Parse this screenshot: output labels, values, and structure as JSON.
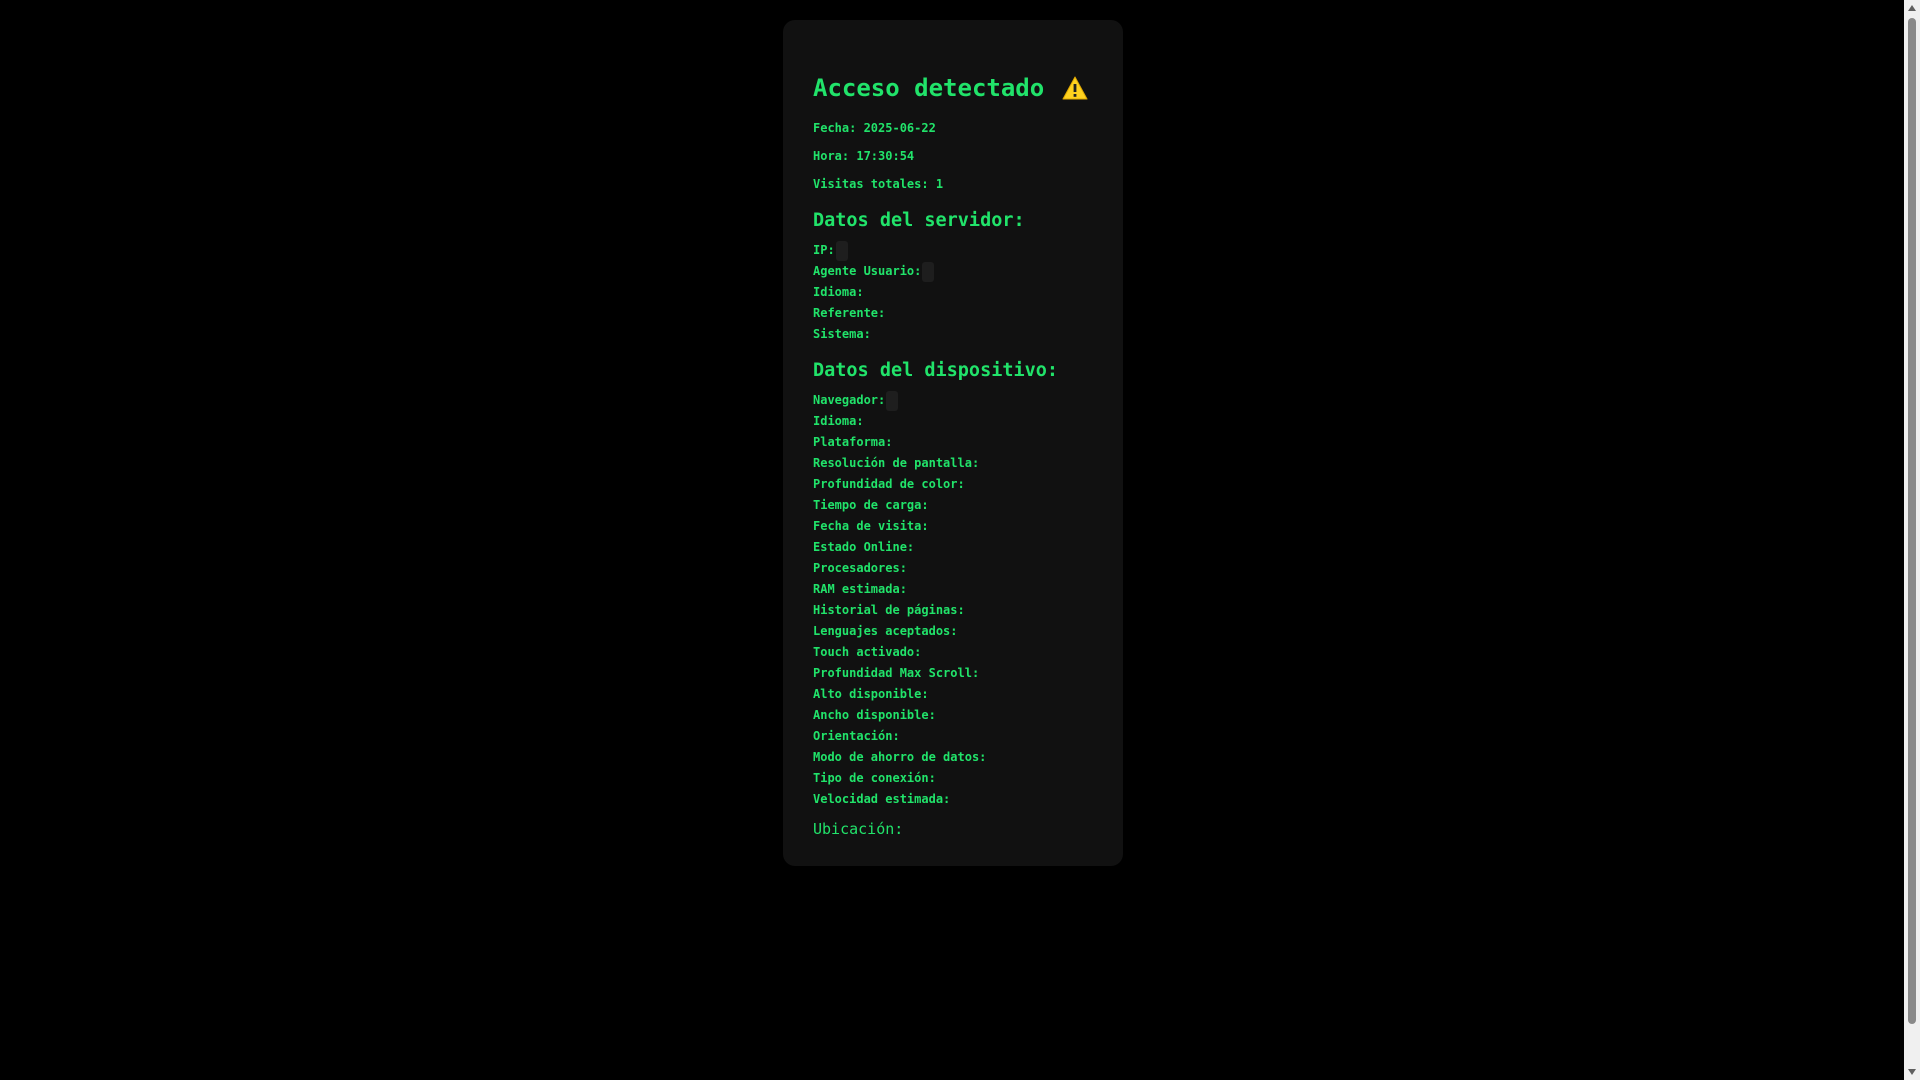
{
  "header": {
    "title": "Acceso detectado",
    "warning_icon": "warning-icon",
    "fecha": "Fecha: 2025-06-22",
    "hora": "Hora: 17:30:54",
    "visitas": "Visitas totales: 1"
  },
  "server": {
    "title": "Datos del servidor:",
    "fields": [
      {
        "label": "IP:"
      },
      {
        "label": "Agente Usuario:"
      },
      {
        "label": "Idioma:"
      },
      {
        "label": "Referente:"
      },
      {
        "label": "Sistema:"
      }
    ]
  },
  "device": {
    "title": "Datos del dispositivo:",
    "fields": [
      {
        "label": "Navegador:"
      },
      {
        "label": "Idioma:"
      },
      {
        "label": "Plataforma:"
      },
      {
        "label": "Resolución de pantalla:"
      },
      {
        "label": "Profundidad de color:"
      },
      {
        "label": "Tiempo de carga:"
      },
      {
        "label": "Fecha de visita:"
      },
      {
        "label": "Estado Online:"
      },
      {
        "label": "Procesadores:"
      },
      {
        "label": "RAM estimada:"
      },
      {
        "label": "Historial de páginas:"
      },
      {
        "label": "Lenguajes aceptados:"
      },
      {
        "label": "Touch activado:"
      },
      {
        "label": "Profundidad Max Scroll:"
      },
      {
        "label": "Alto disponible:"
      },
      {
        "label": "Ancho disponible:"
      },
      {
        "label": "Orientación:"
      },
      {
        "label": "Modo de ahorro de datos:"
      },
      {
        "label": "Tipo de conexión:"
      },
      {
        "label": "Velocidad estimada:"
      }
    ]
  },
  "location": {
    "label": "Ubicación:"
  },
  "colors": {
    "accent": "#21e36a",
    "card_bg": "#111111",
    "page_bg": "#000000",
    "warning": "#ffd21f"
  }
}
